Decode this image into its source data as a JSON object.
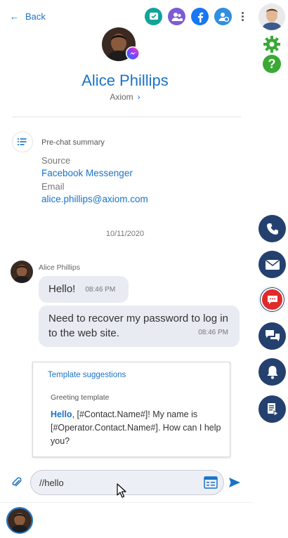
{
  "header": {
    "back_label": "Back",
    "top_icons": [
      "chat-check-icon",
      "contacts-icon",
      "facebook-icon",
      "user-transfer-icon",
      "more-icon"
    ]
  },
  "contact": {
    "name": "Alice Phillips",
    "company": "Axiom",
    "channel_badge": "messenger-icon"
  },
  "prechat": {
    "title": "Pre-chat summary",
    "source_label": "Source",
    "source_value": "Facebook Messenger",
    "email_label": "Email",
    "email_value": "alice.phillips@axiom.com"
  },
  "chat": {
    "date": "10/11/2020",
    "sender": "Alice Phillips",
    "messages": [
      {
        "text": "Hello!",
        "time": "08:46 PM"
      },
      {
        "text": "Need to recover my password to log in to the web site.",
        "time": "08:46 PM"
      }
    ]
  },
  "template": {
    "title": "Template suggestions",
    "name": "Greeting template",
    "highlight": "Hello",
    "body": ", [#Contact.Name#]! My name is [#Operator.Contact.Name#]. How can I help you?"
  },
  "composer": {
    "value": "//hello"
  },
  "rail": {
    "buttons": [
      "phone-icon",
      "email-icon",
      "chat-icon",
      "conversations-icon",
      "notifications-icon",
      "document-icon"
    ],
    "active": "chat-icon"
  },
  "colors": {
    "accent": "#1a73c9",
    "rail_button": "#24406e",
    "active_chat": "#e02a2a",
    "settings_green": "#3aa935",
    "bubble": "#e8ebf2"
  }
}
